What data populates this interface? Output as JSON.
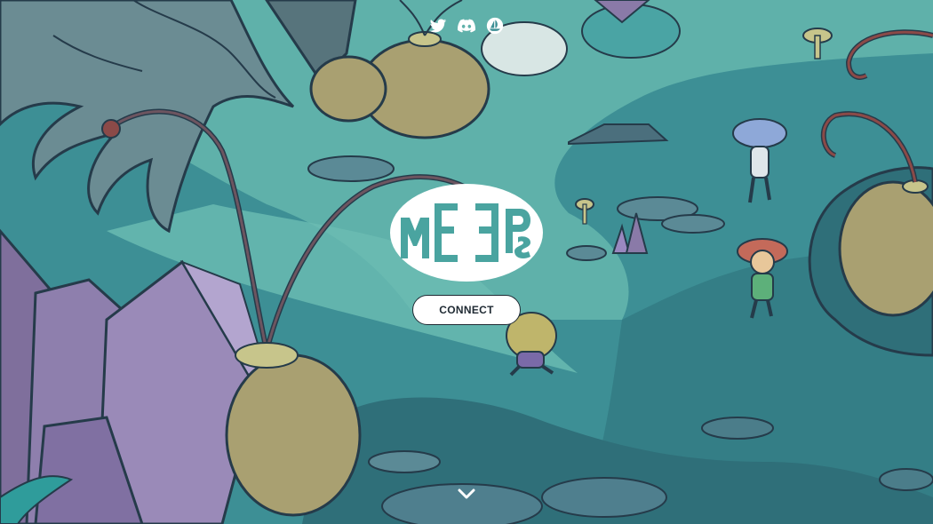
{
  "header": {
    "social_links": [
      {
        "icon": "twitter-icon"
      },
      {
        "icon": "discord-icon"
      },
      {
        "icon": "opensea-icon"
      }
    ]
  },
  "hero": {
    "logo_icon": "meeps-logo",
    "connect_label": "CONNECT",
    "scroll_icon": "chevron-down-icon"
  },
  "colors": {
    "water": "#3d8f95",
    "light_water": "#5fb1aa",
    "crystal": "#8a7aa8",
    "pod": "#a9a071",
    "outline": "#253b4a",
    "button_bg": "#ffffff",
    "button_text": "#1f2a33"
  }
}
